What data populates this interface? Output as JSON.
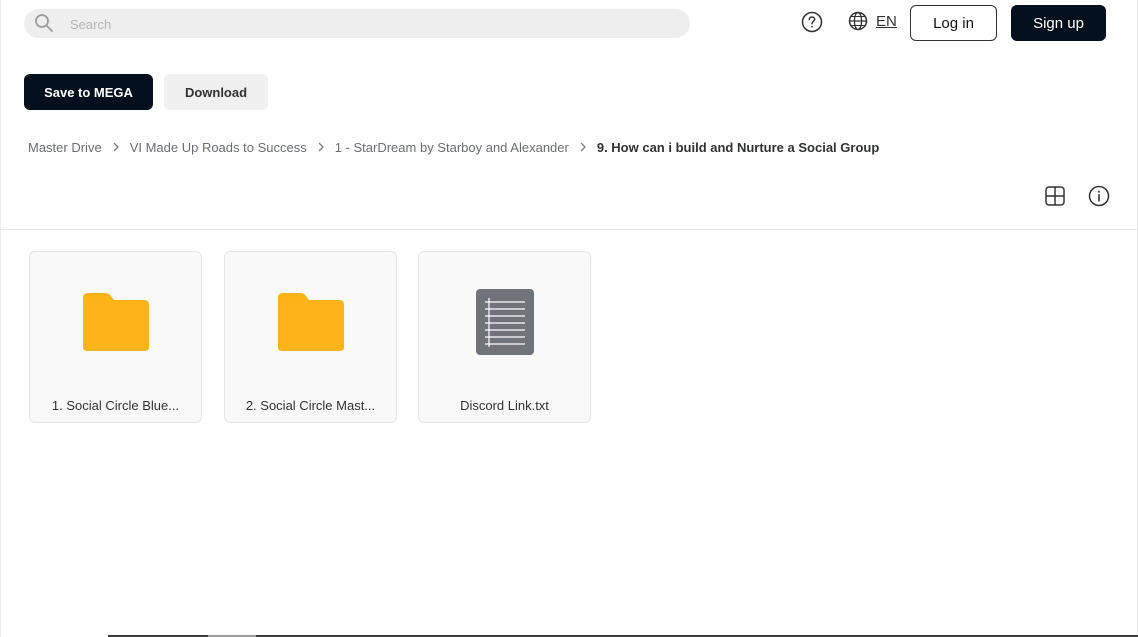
{
  "search": {
    "placeholder": "Search",
    "icon": "search-icon"
  },
  "header": {
    "help_icon": "help-icon",
    "language": {
      "icon": "globe-icon",
      "code": "EN"
    },
    "login_label": "Log in",
    "signup_label": "Sign up"
  },
  "actions": {
    "save_label": "Save to MEGA",
    "download_label": "Download"
  },
  "breadcrumb": {
    "items": [
      "Master Drive",
      "VI Made Up Roads to Success",
      "1 - StarDream by Starboy and Alexander",
      "9. How can i build and Nurture a Social Group"
    ]
  },
  "view_controls": {
    "grid_icon": "grid-view-icon",
    "info_icon": "info-icon"
  },
  "files": [
    {
      "name": "1. Social Circle Blue...",
      "type": "folder"
    },
    {
      "name": "2. Social Circle Mast...",
      "type": "folder"
    },
    {
      "name": "Discord Link.txt",
      "type": "text"
    }
  ],
  "colors": {
    "primary": "#04101e",
    "folder": "#fbb316",
    "text_icon": "#6f737a",
    "search_bg": "#eeeeee"
  }
}
